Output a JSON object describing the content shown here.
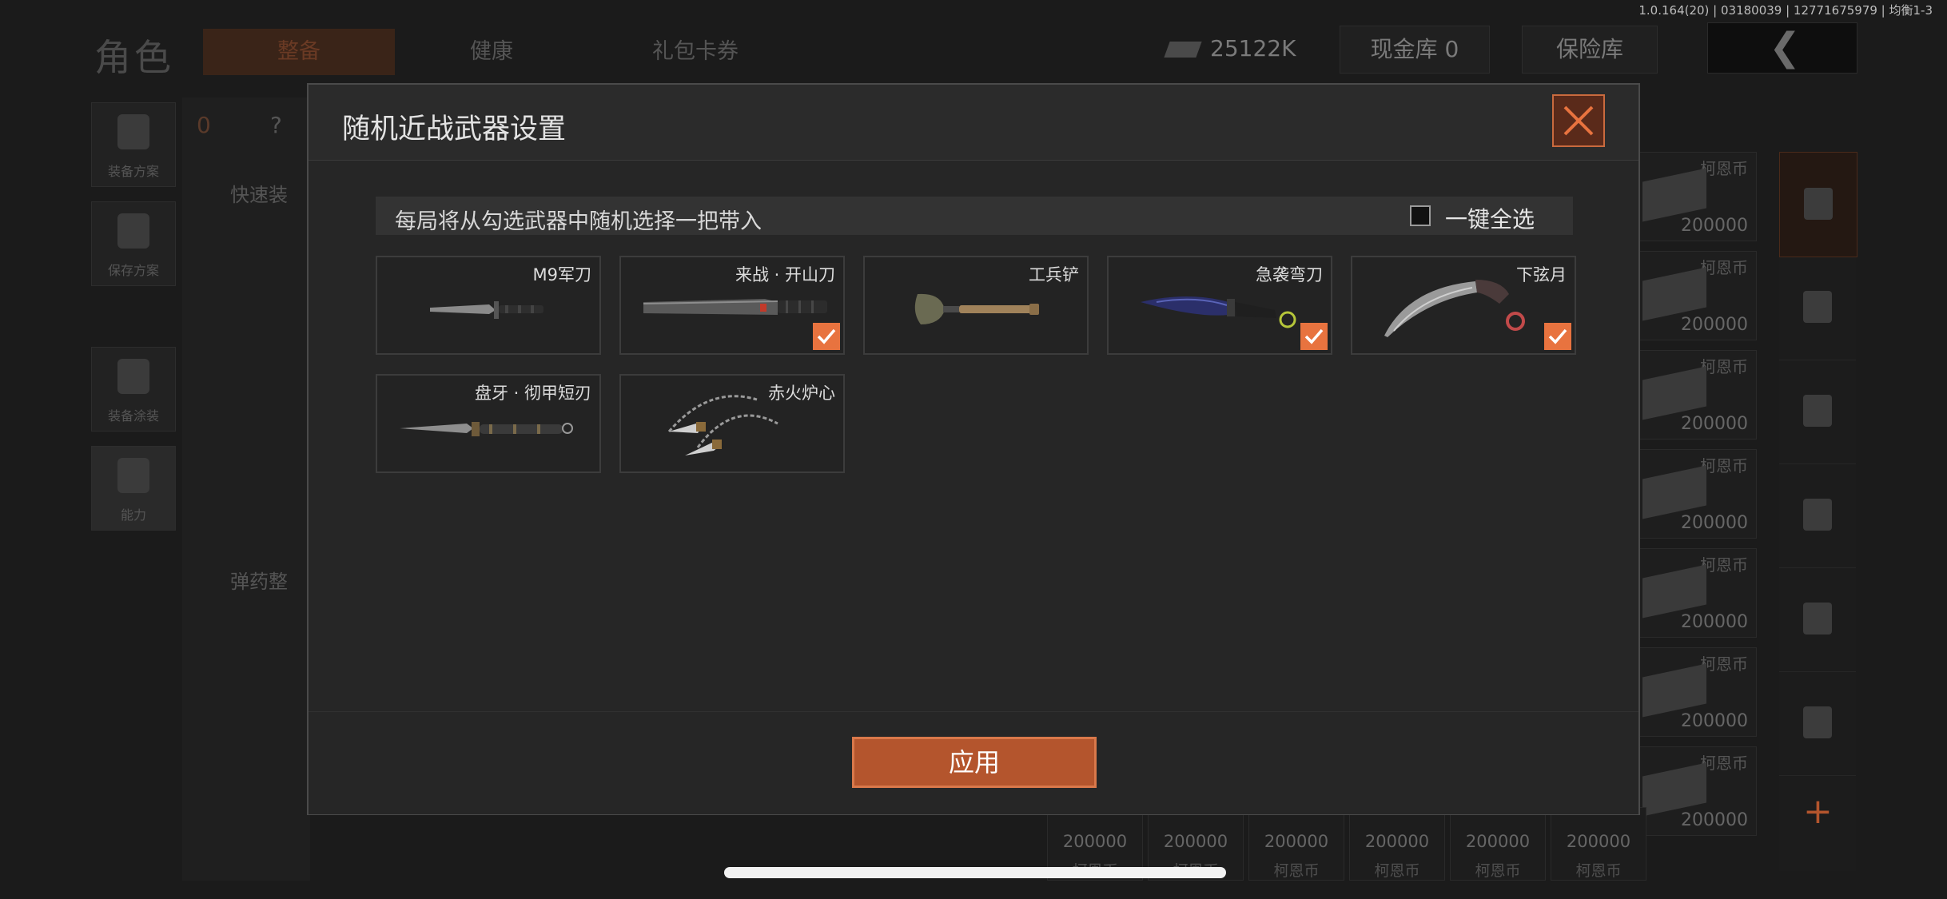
{
  "background": {
    "page_title": "角色",
    "tabs": [
      {
        "label": "整备"
      },
      {
        "label": "健康"
      },
      {
        "label": "礼包卡券"
      }
    ],
    "version": "1.0.164(20) | 03180039 | 12771675979 | 均衡1-3",
    "currency": {
      "balance": "25122K",
      "cash_vault": "现金库 0",
      "insurance": "保险库"
    },
    "left_nav": [
      {
        "label": "装备方案"
      },
      {
        "label": "保存方案"
      },
      {
        "label": "装备涂装"
      },
      {
        "label": "能力"
      }
    ],
    "loadout": {
      "count": "0",
      "unknown": "?",
      "quick_label": "快速装",
      "ammo_label": "弹药整"
    },
    "market_items": [
      {
        "title": "柯恩币",
        "value": "200000"
      },
      {
        "title": "柯恩币",
        "value": "200000"
      },
      {
        "title": "柯恩币",
        "value": "200000"
      },
      {
        "title": "柯恩币",
        "value": "200000"
      },
      {
        "title": "柯恩币",
        "value": "200000"
      },
      {
        "title": "柯恩币",
        "value": "200000"
      },
      {
        "title": "柯恩币",
        "value": "200000"
      },
      {
        "title": "柯恩币",
        "value": "200000"
      }
    ],
    "bottom_items": [
      {
        "value": "200000",
        "currency": "柯恩币"
      },
      {
        "value": "200000",
        "currency": "柯恩币"
      },
      {
        "value": "200000",
        "currency": "柯恩币"
      },
      {
        "value": "200000",
        "currency": "柯恩币"
      },
      {
        "value": "200000",
        "currency": "柯恩币"
      },
      {
        "value": "200000",
        "currency": "柯恩币"
      }
    ]
  },
  "modal": {
    "title": "随机近战武器设置",
    "info": "每局将从勾选武器中随机选择一把带入",
    "select_all_label": "一键全选",
    "select_all_checked": false,
    "weapons": [
      {
        "name": "M9军刀",
        "checked": false,
        "icon": "combat-knife-icon"
      },
      {
        "name": "来战 · 开山刀",
        "checked": true,
        "icon": "machete-icon"
      },
      {
        "name": "工兵铲",
        "checked": false,
        "icon": "shovel-icon"
      },
      {
        "name": "急袭弯刀",
        "checked": true,
        "icon": "curved-blade-icon"
      },
      {
        "name": "下弦月",
        "checked": true,
        "icon": "karambit-icon"
      },
      {
        "name": "盘牙 · 彻甲短刃",
        "checked": false,
        "icon": "short-blade-icon"
      },
      {
        "name": "赤火炉心",
        "checked": false,
        "icon": "rope-dart-icon"
      }
    ],
    "apply_label": "应用",
    "accent_color": "#e8733f"
  }
}
